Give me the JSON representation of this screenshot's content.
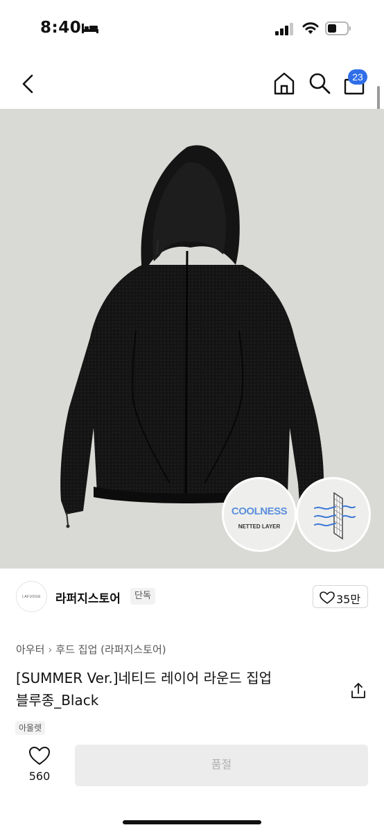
{
  "status_bar": {
    "time": "8:40",
    "icons": [
      "bed-icon",
      "cellular-signal-icon",
      "wifi-icon",
      "battery-icon"
    ]
  },
  "nav": {
    "icons": [
      "back-chevron-icon",
      "home-icon",
      "search-icon",
      "shopping-bag-icon"
    ],
    "cart_count": "23"
  },
  "hero": {
    "image_subject": "black hooded zip-up jacket",
    "badge_coolness": "COOLNESS",
    "badge_netted": "NETTED LAYER",
    "colors": {
      "background": "#d9d9d5",
      "coolness_text": "#5b8fdc",
      "arrow": "#3c78d8"
    }
  },
  "store": {
    "logo_text": "LAFUDGE",
    "name": "라퍼지스토어",
    "tag": "단독",
    "likes": "35만"
  },
  "breadcrumb": {
    "category": "아우터",
    "subcategory": "후드 집업 (라퍼지스토어)"
  },
  "product": {
    "title_line1": "[SUMMER Ver.]네티드 레이어 라운드 집업",
    "title_line2": "블루종_Black",
    "tag": "아울렛"
  },
  "bottom_bar": {
    "wish_count": "560",
    "buy_label": "품절"
  }
}
